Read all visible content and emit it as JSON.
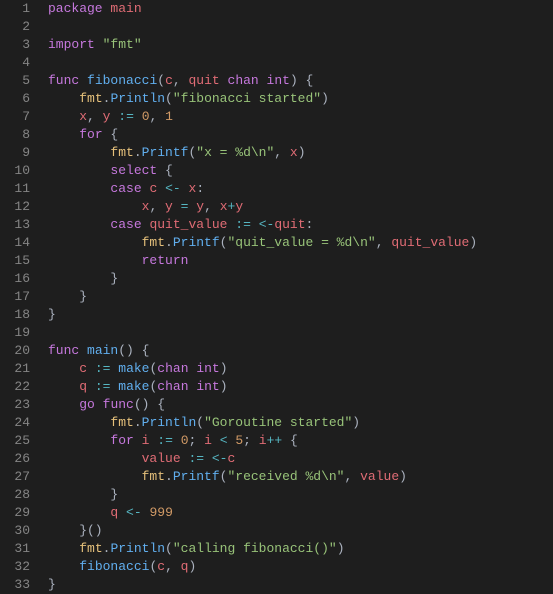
{
  "lines": [
    [
      [
        "kw",
        "package"
      ],
      [
        "pn",
        " "
      ],
      [
        "id",
        "main"
      ]
    ],
    [],
    [
      [
        "kw",
        "import"
      ],
      [
        "pn",
        " "
      ],
      [
        "str",
        "\"fmt\""
      ]
    ],
    [],
    [
      [
        "kw",
        "func"
      ],
      [
        "pn",
        " "
      ],
      [
        "fn",
        "fibonacci"
      ],
      [
        "pn",
        "("
      ],
      [
        "id",
        "c"
      ],
      [
        "pn",
        ", "
      ],
      [
        "id",
        "quit"
      ],
      [
        "pn",
        " "
      ],
      [
        "kw",
        "chan"
      ],
      [
        "pn",
        " "
      ],
      [
        "ty",
        "int"
      ],
      [
        "pn",
        ") {"
      ]
    ],
    [
      [
        "pn",
        "    "
      ],
      [
        "pkg",
        "fmt"
      ],
      [
        "pn",
        "."
      ],
      [
        "fn",
        "Println"
      ],
      [
        "pn",
        "("
      ],
      [
        "str",
        "\"fibonacci started\""
      ],
      [
        "pn",
        ")"
      ]
    ],
    [
      [
        "pn",
        "    "
      ],
      [
        "id",
        "x"
      ],
      [
        "pn",
        ", "
      ],
      [
        "id",
        "y"
      ],
      [
        "pn",
        " "
      ],
      [
        "op",
        ":="
      ],
      [
        "pn",
        " "
      ],
      [
        "num",
        "0"
      ],
      [
        "pn",
        ", "
      ],
      [
        "num",
        "1"
      ]
    ],
    [
      [
        "pn",
        "    "
      ],
      [
        "kw",
        "for"
      ],
      [
        "pn",
        " {"
      ]
    ],
    [
      [
        "pn",
        "        "
      ],
      [
        "pkg",
        "fmt"
      ],
      [
        "pn",
        "."
      ],
      [
        "fn",
        "Printf"
      ],
      [
        "pn",
        "("
      ],
      [
        "str",
        "\"x = %d\\n\""
      ],
      [
        "pn",
        ", "
      ],
      [
        "id",
        "x"
      ],
      [
        "pn",
        ")"
      ]
    ],
    [
      [
        "pn",
        "        "
      ],
      [
        "kw",
        "select"
      ],
      [
        "pn",
        " {"
      ]
    ],
    [
      [
        "pn",
        "        "
      ],
      [
        "kw",
        "case"
      ],
      [
        "pn",
        " "
      ],
      [
        "id",
        "c"
      ],
      [
        "pn",
        " "
      ],
      [
        "op",
        "<-"
      ],
      [
        "pn",
        " "
      ],
      [
        "id",
        "x"
      ],
      [
        "pn",
        ":"
      ]
    ],
    [
      [
        "pn",
        "            "
      ],
      [
        "id",
        "x"
      ],
      [
        "pn",
        ", "
      ],
      [
        "id",
        "y"
      ],
      [
        "pn",
        " "
      ],
      [
        "op",
        "="
      ],
      [
        "pn",
        " "
      ],
      [
        "id",
        "y"
      ],
      [
        "pn",
        ", "
      ],
      [
        "id",
        "x"
      ],
      [
        "op",
        "+"
      ],
      [
        "id",
        "y"
      ]
    ],
    [
      [
        "pn",
        "        "
      ],
      [
        "kw",
        "case"
      ],
      [
        "pn",
        " "
      ],
      [
        "id",
        "quit_value"
      ],
      [
        "pn",
        " "
      ],
      [
        "op",
        ":="
      ],
      [
        "pn",
        " "
      ],
      [
        "op",
        "<-"
      ],
      [
        "id",
        "quit"
      ],
      [
        "pn",
        ":"
      ]
    ],
    [
      [
        "pn",
        "            "
      ],
      [
        "pkg",
        "fmt"
      ],
      [
        "pn",
        "."
      ],
      [
        "fn",
        "Printf"
      ],
      [
        "pn",
        "("
      ],
      [
        "str",
        "\"quit_value = %d\\n\""
      ],
      [
        "pn",
        ", "
      ],
      [
        "id",
        "quit_value"
      ],
      [
        "pn",
        ")"
      ]
    ],
    [
      [
        "pn",
        "            "
      ],
      [
        "kw",
        "return"
      ]
    ],
    [
      [
        "pn",
        "        }"
      ]
    ],
    [
      [
        "pn",
        "    }"
      ]
    ],
    [
      [
        "pn",
        "}"
      ]
    ],
    [],
    [
      [
        "kw",
        "func"
      ],
      [
        "pn",
        " "
      ],
      [
        "fn",
        "main"
      ],
      [
        "pn",
        "() {"
      ]
    ],
    [
      [
        "pn",
        "    "
      ],
      [
        "id",
        "c"
      ],
      [
        "pn",
        " "
      ],
      [
        "op",
        ":="
      ],
      [
        "pn",
        " "
      ],
      [
        "fn",
        "make"
      ],
      [
        "pn",
        "("
      ],
      [
        "kw",
        "chan"
      ],
      [
        "pn",
        " "
      ],
      [
        "ty",
        "int"
      ],
      [
        "pn",
        ")"
      ]
    ],
    [
      [
        "pn",
        "    "
      ],
      [
        "id",
        "q"
      ],
      [
        "pn",
        " "
      ],
      [
        "op",
        ":="
      ],
      [
        "pn",
        " "
      ],
      [
        "fn",
        "make"
      ],
      [
        "pn",
        "("
      ],
      [
        "kw",
        "chan"
      ],
      [
        "pn",
        " "
      ],
      [
        "ty",
        "int"
      ],
      [
        "pn",
        ")"
      ]
    ],
    [
      [
        "pn",
        "    "
      ],
      [
        "kw",
        "go"
      ],
      [
        "pn",
        " "
      ],
      [
        "kw",
        "func"
      ],
      [
        "pn",
        "() {"
      ]
    ],
    [
      [
        "pn",
        "        "
      ],
      [
        "pkg",
        "fmt"
      ],
      [
        "pn",
        "."
      ],
      [
        "fn",
        "Println"
      ],
      [
        "pn",
        "("
      ],
      [
        "str",
        "\"Goroutine started\""
      ],
      [
        "pn",
        ")"
      ]
    ],
    [
      [
        "pn",
        "        "
      ],
      [
        "kw",
        "for"
      ],
      [
        "pn",
        " "
      ],
      [
        "id",
        "i"
      ],
      [
        "pn",
        " "
      ],
      [
        "op",
        ":="
      ],
      [
        "pn",
        " "
      ],
      [
        "num",
        "0"
      ],
      [
        "pn",
        "; "
      ],
      [
        "id",
        "i"
      ],
      [
        "pn",
        " "
      ],
      [
        "op",
        "<"
      ],
      [
        "pn",
        " "
      ],
      [
        "num",
        "5"
      ],
      [
        "pn",
        "; "
      ],
      [
        "id",
        "i"
      ],
      [
        "op",
        "++"
      ],
      [
        "pn",
        " {"
      ]
    ],
    [
      [
        "pn",
        "            "
      ],
      [
        "id",
        "value"
      ],
      [
        "pn",
        " "
      ],
      [
        "op",
        ":="
      ],
      [
        "pn",
        " "
      ],
      [
        "op",
        "<-"
      ],
      [
        "id",
        "c"
      ]
    ],
    [
      [
        "pn",
        "            "
      ],
      [
        "pkg",
        "fmt"
      ],
      [
        "pn",
        "."
      ],
      [
        "fn",
        "Printf"
      ],
      [
        "pn",
        "("
      ],
      [
        "str",
        "\"received %d\\n\""
      ],
      [
        "pn",
        ", "
      ],
      [
        "id",
        "value"
      ],
      [
        "pn",
        ")"
      ]
    ],
    [
      [
        "pn",
        "        }"
      ]
    ],
    [
      [
        "pn",
        "        "
      ],
      [
        "id",
        "q"
      ],
      [
        "pn",
        " "
      ],
      [
        "op",
        "<-"
      ],
      [
        "pn",
        " "
      ],
      [
        "num",
        "999"
      ]
    ],
    [
      [
        "pn",
        "    }()"
      ]
    ],
    [
      [
        "pn",
        "    "
      ],
      [
        "pkg",
        "fmt"
      ],
      [
        "pn",
        "."
      ],
      [
        "fn",
        "Println"
      ],
      [
        "pn",
        "("
      ],
      [
        "str",
        "\"calling fibonacci()\""
      ],
      [
        "pn",
        ")"
      ]
    ],
    [
      [
        "pn",
        "    "
      ],
      [
        "fn",
        "fibonacci"
      ],
      [
        "pn",
        "("
      ],
      [
        "id",
        "c"
      ],
      [
        "pn",
        ", "
      ],
      [
        "id",
        "q"
      ],
      [
        "pn",
        ")"
      ]
    ],
    [
      [
        "pn",
        "}"
      ]
    ]
  ],
  "lineCount": 33
}
